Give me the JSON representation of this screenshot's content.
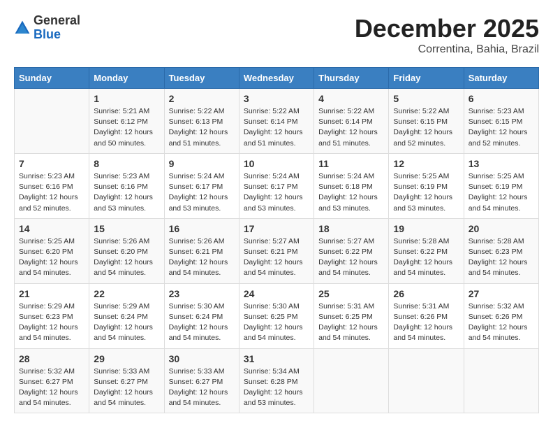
{
  "header": {
    "logo_general": "General",
    "logo_blue": "Blue",
    "month_title": "December 2025",
    "location": "Correntina, Bahia, Brazil"
  },
  "calendar": {
    "days_of_week": [
      "Sunday",
      "Monday",
      "Tuesday",
      "Wednesday",
      "Thursday",
      "Friday",
      "Saturday"
    ],
    "weeks": [
      [
        {
          "day": "",
          "info": ""
        },
        {
          "day": "1",
          "info": "Sunrise: 5:21 AM\nSunset: 6:12 PM\nDaylight: 12 hours\nand 50 minutes."
        },
        {
          "day": "2",
          "info": "Sunrise: 5:22 AM\nSunset: 6:13 PM\nDaylight: 12 hours\nand 51 minutes."
        },
        {
          "day": "3",
          "info": "Sunrise: 5:22 AM\nSunset: 6:14 PM\nDaylight: 12 hours\nand 51 minutes."
        },
        {
          "day": "4",
          "info": "Sunrise: 5:22 AM\nSunset: 6:14 PM\nDaylight: 12 hours\nand 51 minutes."
        },
        {
          "day": "5",
          "info": "Sunrise: 5:22 AM\nSunset: 6:15 PM\nDaylight: 12 hours\nand 52 minutes."
        },
        {
          "day": "6",
          "info": "Sunrise: 5:23 AM\nSunset: 6:15 PM\nDaylight: 12 hours\nand 52 minutes."
        }
      ],
      [
        {
          "day": "7",
          "info": "Sunrise: 5:23 AM\nSunset: 6:16 PM\nDaylight: 12 hours\nand 52 minutes."
        },
        {
          "day": "8",
          "info": "Sunrise: 5:23 AM\nSunset: 6:16 PM\nDaylight: 12 hours\nand 53 minutes."
        },
        {
          "day": "9",
          "info": "Sunrise: 5:24 AM\nSunset: 6:17 PM\nDaylight: 12 hours\nand 53 minutes."
        },
        {
          "day": "10",
          "info": "Sunrise: 5:24 AM\nSunset: 6:17 PM\nDaylight: 12 hours\nand 53 minutes."
        },
        {
          "day": "11",
          "info": "Sunrise: 5:24 AM\nSunset: 6:18 PM\nDaylight: 12 hours\nand 53 minutes."
        },
        {
          "day": "12",
          "info": "Sunrise: 5:25 AM\nSunset: 6:19 PM\nDaylight: 12 hours\nand 53 minutes."
        },
        {
          "day": "13",
          "info": "Sunrise: 5:25 AM\nSunset: 6:19 PM\nDaylight: 12 hours\nand 54 minutes."
        }
      ],
      [
        {
          "day": "14",
          "info": "Sunrise: 5:25 AM\nSunset: 6:20 PM\nDaylight: 12 hours\nand 54 minutes."
        },
        {
          "day": "15",
          "info": "Sunrise: 5:26 AM\nSunset: 6:20 PM\nDaylight: 12 hours\nand 54 minutes."
        },
        {
          "day": "16",
          "info": "Sunrise: 5:26 AM\nSunset: 6:21 PM\nDaylight: 12 hours\nand 54 minutes."
        },
        {
          "day": "17",
          "info": "Sunrise: 5:27 AM\nSunset: 6:21 PM\nDaylight: 12 hours\nand 54 minutes."
        },
        {
          "day": "18",
          "info": "Sunrise: 5:27 AM\nSunset: 6:22 PM\nDaylight: 12 hours\nand 54 minutes."
        },
        {
          "day": "19",
          "info": "Sunrise: 5:28 AM\nSunset: 6:22 PM\nDaylight: 12 hours\nand 54 minutes."
        },
        {
          "day": "20",
          "info": "Sunrise: 5:28 AM\nSunset: 6:23 PM\nDaylight: 12 hours\nand 54 minutes."
        }
      ],
      [
        {
          "day": "21",
          "info": "Sunrise: 5:29 AM\nSunset: 6:23 PM\nDaylight: 12 hours\nand 54 minutes."
        },
        {
          "day": "22",
          "info": "Sunrise: 5:29 AM\nSunset: 6:24 PM\nDaylight: 12 hours\nand 54 minutes."
        },
        {
          "day": "23",
          "info": "Sunrise: 5:30 AM\nSunset: 6:24 PM\nDaylight: 12 hours\nand 54 minutes."
        },
        {
          "day": "24",
          "info": "Sunrise: 5:30 AM\nSunset: 6:25 PM\nDaylight: 12 hours\nand 54 minutes."
        },
        {
          "day": "25",
          "info": "Sunrise: 5:31 AM\nSunset: 6:25 PM\nDaylight: 12 hours\nand 54 minutes."
        },
        {
          "day": "26",
          "info": "Sunrise: 5:31 AM\nSunset: 6:26 PM\nDaylight: 12 hours\nand 54 minutes."
        },
        {
          "day": "27",
          "info": "Sunrise: 5:32 AM\nSunset: 6:26 PM\nDaylight: 12 hours\nand 54 minutes."
        }
      ],
      [
        {
          "day": "28",
          "info": "Sunrise: 5:32 AM\nSunset: 6:27 PM\nDaylight: 12 hours\nand 54 minutes."
        },
        {
          "day": "29",
          "info": "Sunrise: 5:33 AM\nSunset: 6:27 PM\nDaylight: 12 hours\nand 54 minutes."
        },
        {
          "day": "30",
          "info": "Sunrise: 5:33 AM\nSunset: 6:27 PM\nDaylight: 12 hours\nand 54 minutes."
        },
        {
          "day": "31",
          "info": "Sunrise: 5:34 AM\nSunset: 6:28 PM\nDaylight: 12 hours\nand 53 minutes."
        },
        {
          "day": "",
          "info": ""
        },
        {
          "day": "",
          "info": ""
        },
        {
          "day": "",
          "info": ""
        }
      ]
    ]
  }
}
